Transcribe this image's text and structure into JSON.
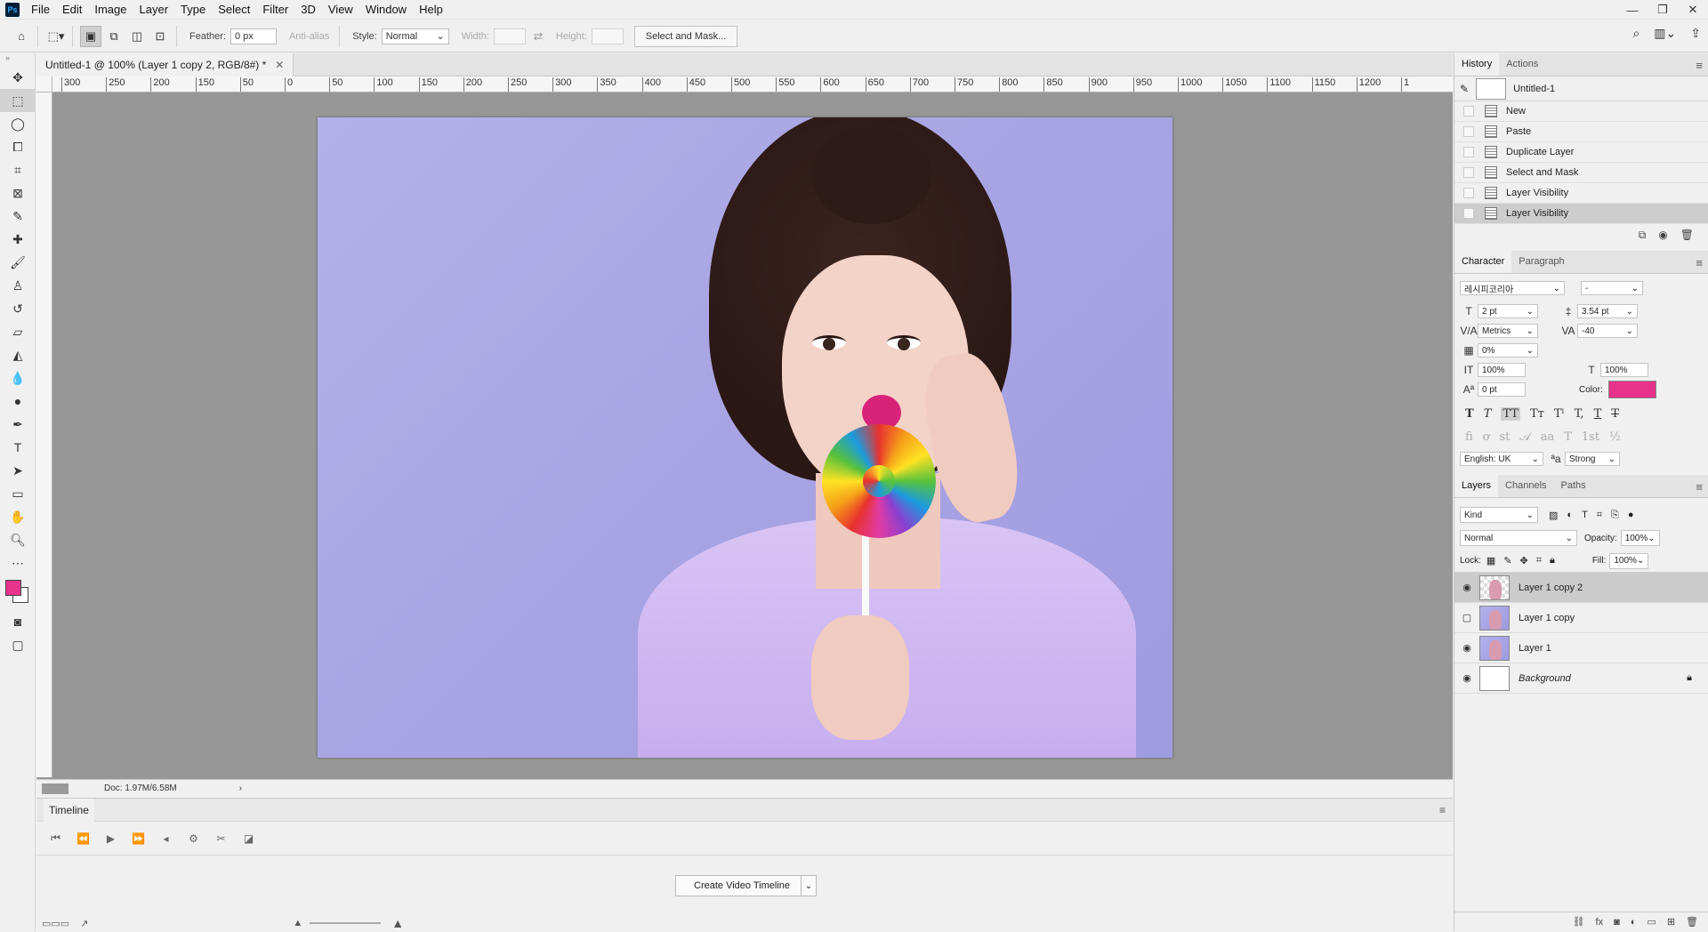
{
  "app": {
    "logo": "Ps"
  },
  "menu": [
    "File",
    "Edit",
    "Image",
    "Layer",
    "Type",
    "Select",
    "Filter",
    "3D",
    "View",
    "Window",
    "Help"
  ],
  "window_controls": [
    "—",
    "❐",
    "✕"
  ],
  "options": {
    "feather_label": "Feather:",
    "feather_value": "0 px",
    "antialias_label": "Anti-alias",
    "style_label": "Style:",
    "style_value": "Normal",
    "width_label": "Width:",
    "height_label": "Height:",
    "mask_button": "Select and Mask..."
  },
  "document": {
    "tab_title": "Untitled-1 @ 100% (Layer 1 copy 2, RGB/8#) *",
    "close": "✕",
    "status": "Doc: 1.97M/6.58M",
    "ruler_labels": [
      "300",
      "250",
      "200",
      "150",
      "50",
      "0",
      "50",
      "100",
      "150",
      "200",
      "250",
      "300",
      "350",
      "400",
      "450",
      "500",
      "550",
      "600",
      "650",
      "700",
      "750",
      "800",
      "850",
      "900",
      "950",
      "1000",
      "1050",
      "1100",
      "1150",
      "1200",
      "1"
    ]
  },
  "timeline": {
    "title": "Timeline",
    "create_button": "Create Video Timeline"
  },
  "history": {
    "tabs": [
      "History",
      "Actions"
    ],
    "snapshot": "Untitled-1",
    "items": [
      "New",
      "Paste",
      "Duplicate Layer",
      "Select and Mask",
      "Layer Visibility",
      "Layer Visibility"
    ]
  },
  "character": {
    "tabs": [
      "Character",
      "Paragraph"
    ],
    "font_family": "레시피코리아",
    "font_style": "-",
    "font_size": "2 pt",
    "leading": "3.54 pt",
    "kerning": "Metrics",
    "tracking": "-40",
    "tsume": "0%",
    "vscale": "100%",
    "hscale": "100%",
    "baseline": "0 pt",
    "color_label": "Color:",
    "color": "#e8338c",
    "language": "English: UK",
    "aa_label": "ªa",
    "antialias": "Strong"
  },
  "layers": {
    "tabs": [
      "Layers",
      "Channels",
      "Paths"
    ],
    "filter": "Kind",
    "blend": "Normal",
    "opacity_label": "Opacity:",
    "opacity": "100%",
    "lock_label": "Lock:",
    "fill_label": "Fill:",
    "fill": "100%",
    "items": [
      {
        "name": "Layer 1 copy 2",
        "visible": true,
        "selected": true
      },
      {
        "name": "Layer 1 copy",
        "visible": false,
        "selected": false
      },
      {
        "name": "Layer 1",
        "visible": true,
        "selected": false
      },
      {
        "name": "Background",
        "visible": true,
        "selected": false,
        "locked": true
      }
    ]
  }
}
